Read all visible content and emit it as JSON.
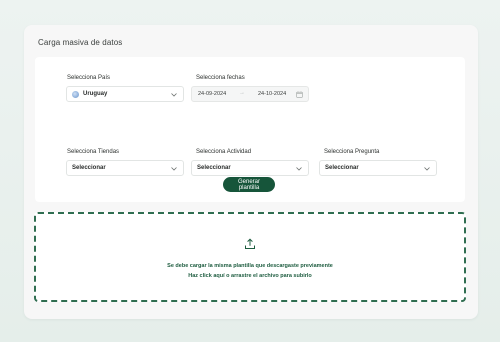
{
  "card": {
    "title": "Carga masiva de datos"
  },
  "form": {
    "pais": {
      "label": "Selecciona País",
      "value": "Uruguay",
      "icon": "globe-icon"
    },
    "fechas": {
      "label": "Selecciona fechas",
      "start": "24-09-2024",
      "end": "24-10-2024",
      "separator": "→",
      "icon": "calendar-icon"
    },
    "tiendas": {
      "label": "Selecciona Tiendas",
      "value": "Seleccionar"
    },
    "actividad": {
      "label": "Selecciona Actividad",
      "value": "Seleccionar"
    },
    "pregunta": {
      "label": "Selecciona Pregunta",
      "value": "Seleccionar"
    },
    "generate_label": "Generar plantilla"
  },
  "dropzone": {
    "line1": "Se debe cargar la misma plantilla que descargaste previamente",
    "line2": "Haz click aquí o arrastre el archivo para subirlo",
    "icon": "upload-icon"
  },
  "colors": {
    "primary": "#16553a",
    "dropzone_border": "#2f6d50",
    "dropzone_text": "#1d5c3f"
  }
}
